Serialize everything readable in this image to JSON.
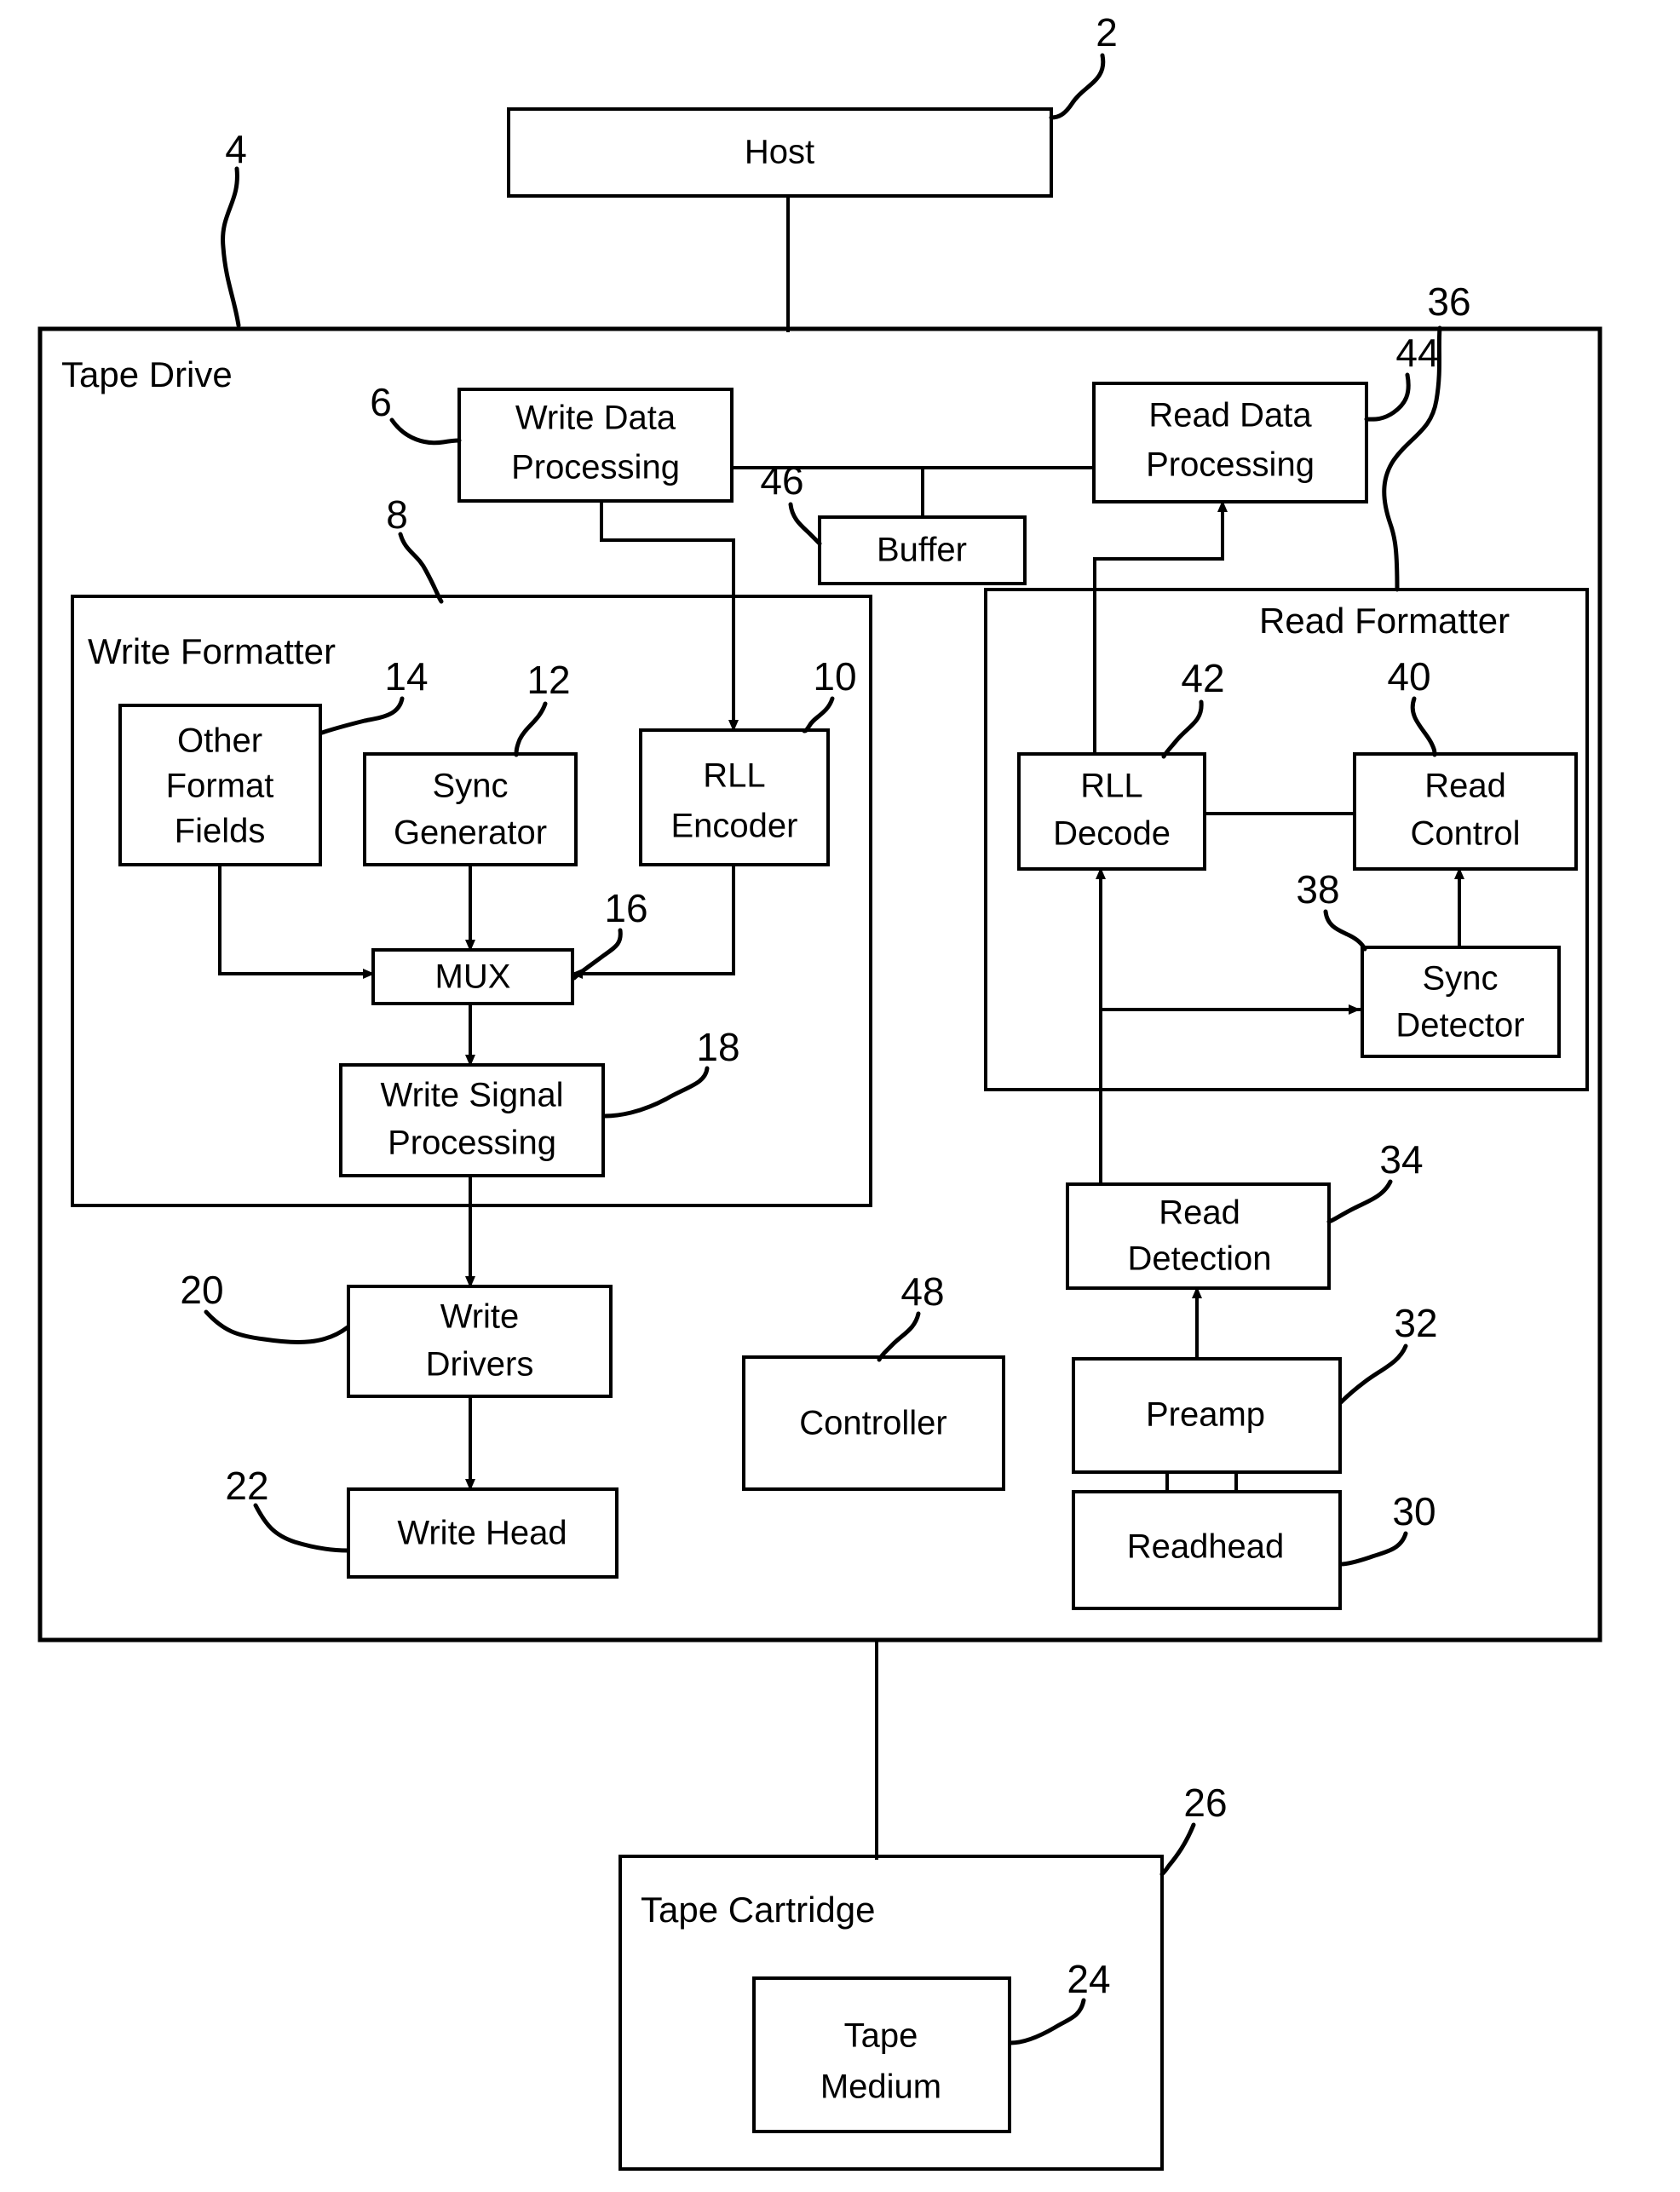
{
  "figure": {
    "type": "patent-block-diagram",
    "title": "Tape drive read/write data path block diagram",
    "background_color": "#ffffff",
    "line_color": "#000000"
  },
  "containers": [
    {
      "id": "tape_drive",
      "label": "Tape Drive",
      "ref": "4"
    },
    {
      "id": "write_formatter",
      "label": "Write Formatter",
      "ref": "8"
    },
    {
      "id": "read_formatter",
      "label": "Read Formatter",
      "ref": "36"
    },
    {
      "id": "tape_cartridge",
      "label": "Tape Cartridge",
      "ref": "26"
    }
  ],
  "blocks": [
    {
      "id": "host",
      "label": "Host",
      "ref": "2"
    },
    {
      "id": "write_data_proc",
      "label": "Write Data Processing",
      "ref": "6"
    },
    {
      "id": "read_data_proc",
      "label": "Read Data Processing",
      "ref": "44"
    },
    {
      "id": "buffer",
      "label": "Buffer",
      "ref": "46"
    },
    {
      "id": "other_fmt",
      "label": "Other Format Fields",
      "ref": "14"
    },
    {
      "id": "sync_gen",
      "label": "Sync Generator",
      "ref": "12"
    },
    {
      "id": "rll_encoder",
      "label": "RLL Encoder",
      "ref": "10"
    },
    {
      "id": "mux",
      "label": "MUX",
      "ref": "16"
    },
    {
      "id": "write_sig_proc",
      "label": "Write Signal Processing",
      "ref": "18"
    },
    {
      "id": "write_drivers",
      "label": "Write Drivers",
      "ref": "20"
    },
    {
      "id": "write_head",
      "label": "Write Head",
      "ref": "22"
    },
    {
      "id": "controller",
      "label": "Controller",
      "ref": "48"
    },
    {
      "id": "rll_decode",
      "label": "RLL Decode",
      "ref": "42"
    },
    {
      "id": "read_control",
      "label": "Read Control",
      "ref": "40"
    },
    {
      "id": "sync_detector",
      "label": "Sync Detector",
      "ref": "38"
    },
    {
      "id": "read_detection",
      "label": "Read Detection",
      "ref": "34"
    },
    {
      "id": "preamp",
      "label": "Preamp",
      "ref": "32"
    },
    {
      "id": "readhead",
      "label": "Readhead",
      "ref": "30"
    },
    {
      "id": "tape_medium",
      "label": "Tape Medium",
      "ref": "24"
    }
  ],
  "block_lines": {
    "host": [
      "Host"
    ],
    "write_data_proc": [
      "Write Data",
      "Processing"
    ],
    "read_data_proc": [
      "Read Data",
      "Processing"
    ],
    "buffer": [
      "Buffer"
    ],
    "other_fmt": [
      "Other",
      "Format",
      "Fields"
    ],
    "sync_gen": [
      "Sync",
      "Generator"
    ],
    "rll_encoder": [
      "RLL",
      "Encoder"
    ],
    "mux": [
      "MUX"
    ],
    "write_sig_proc": [
      "Write Signal",
      "Processing"
    ],
    "write_drivers": [
      "Write",
      "Drivers"
    ],
    "write_head": [
      "Write Head"
    ],
    "controller": [
      "Controller"
    ],
    "rll_decode": [
      "RLL",
      "Decode"
    ],
    "read_control": [
      "Read",
      "Control"
    ],
    "sync_detector": [
      "Sync",
      "Detector"
    ],
    "read_detection": [
      "Read",
      "Detection"
    ],
    "preamp": [
      "Preamp"
    ],
    "readhead": [
      "Readhead"
    ],
    "tape_medium": [
      "Tape",
      "Medium"
    ]
  },
  "reference_numerals": [
    "2",
    "4",
    "6",
    "8",
    "10",
    "12",
    "14",
    "16",
    "18",
    "20",
    "22",
    "24",
    "26",
    "30",
    "32",
    "34",
    "36",
    "38",
    "40",
    "42",
    "44",
    "46",
    "48"
  ]
}
